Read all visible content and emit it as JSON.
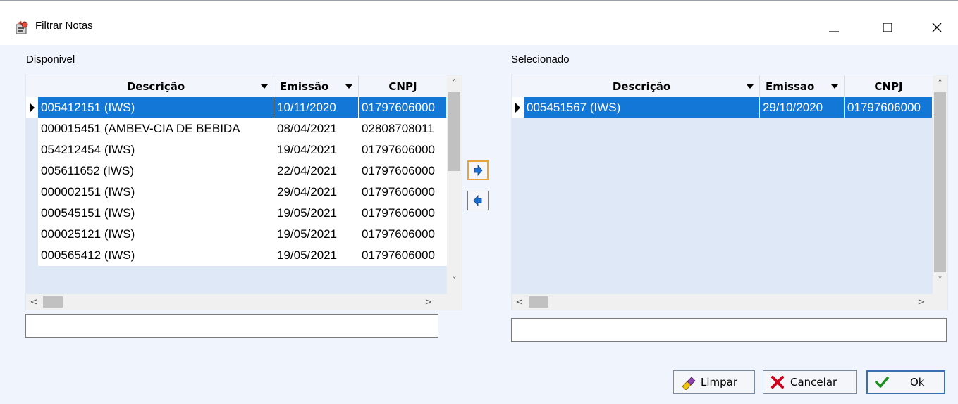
{
  "window": {
    "title": "Filtrar Notas"
  },
  "icons": {
    "app": "form-icon",
    "minimize": "minimize-icon",
    "maximize": "maximize-icon",
    "close": "close-icon",
    "move_right": "arrow-right-icon",
    "move_left": "arrow-left-icon",
    "limpar": "eraser-icon",
    "cancelar": "x-icon",
    "ok": "checkmark-icon"
  },
  "colors": {
    "selection": "#1277d7",
    "background": "#f0f4fc",
    "grid_empty": "#dfe8f7"
  },
  "available": {
    "label": "Disponivel",
    "columns": [
      "Descrição",
      "Emissão",
      "CNPJ"
    ],
    "rows": [
      {
        "desc": "005412151 (IWS)",
        "date": "10/11/2020",
        "cnpj": "01797606000",
        "selected": true
      },
      {
        "desc": "000015451 (AMBEV-CIA DE BEBIDA",
        "date": "08/04/2021",
        "cnpj": "02808708011",
        "selected": false
      },
      {
        "desc": "054212454 (IWS)",
        "date": "19/04/2021",
        "cnpj": "01797606000",
        "selected": false
      },
      {
        "desc": "005611652 (IWS)",
        "date": "22/04/2021",
        "cnpj": "01797606000",
        "selected": false
      },
      {
        "desc": "000002151 (IWS)",
        "date": "29/04/2021",
        "cnpj": "01797606000",
        "selected": false
      },
      {
        "desc": "000545151 (IWS)",
        "date": "19/05/2021",
        "cnpj": "01797606000",
        "selected": false
      },
      {
        "desc": "000025121 (IWS)",
        "date": "19/05/2021",
        "cnpj": "01797606000",
        "selected": false
      },
      {
        "desc": "000565412 (IWS)",
        "date": "19/05/2021",
        "cnpj": "01797606000",
        "selected": false
      }
    ],
    "filter_value": ""
  },
  "selected": {
    "label": "Selecionado",
    "columns": [
      "Descrição",
      "Emissao",
      "CNPJ"
    ],
    "rows": [
      {
        "desc": "005451567 (IWS)",
        "date": "29/10/2020",
        "cnpj": "01797606000",
        "selected": true
      }
    ],
    "filter_value": ""
  },
  "buttons": {
    "limpar": "Limpar",
    "cancelar": "Cancelar",
    "ok": "Ok"
  }
}
